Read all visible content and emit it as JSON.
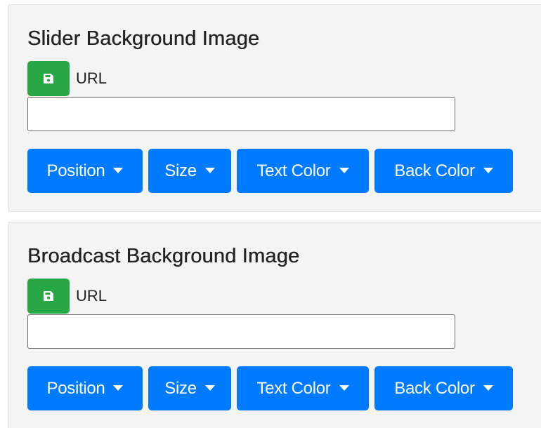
{
  "sections": [
    {
      "title": "Slider Background Image",
      "url_label": "URL",
      "url_value": "",
      "buttons": {
        "position": "Position",
        "size": "Size",
        "text_color": "Text Color",
        "back_color": "Back Color"
      }
    },
    {
      "title": "Broadcast Background Image",
      "url_label": "URL",
      "url_value": "",
      "buttons": {
        "position": "Position",
        "size": "Size",
        "text_color": "Text Color",
        "back_color": "Back Color"
      }
    }
  ],
  "icons": {
    "save": "save-icon",
    "dropdown": "caret-down-icon"
  },
  "colors": {
    "panel_background": "#f4f4f4",
    "save_button": "#28a745",
    "dropdown_button": "#007bff",
    "button_text": "#ffffff",
    "title_text": "#222222"
  }
}
